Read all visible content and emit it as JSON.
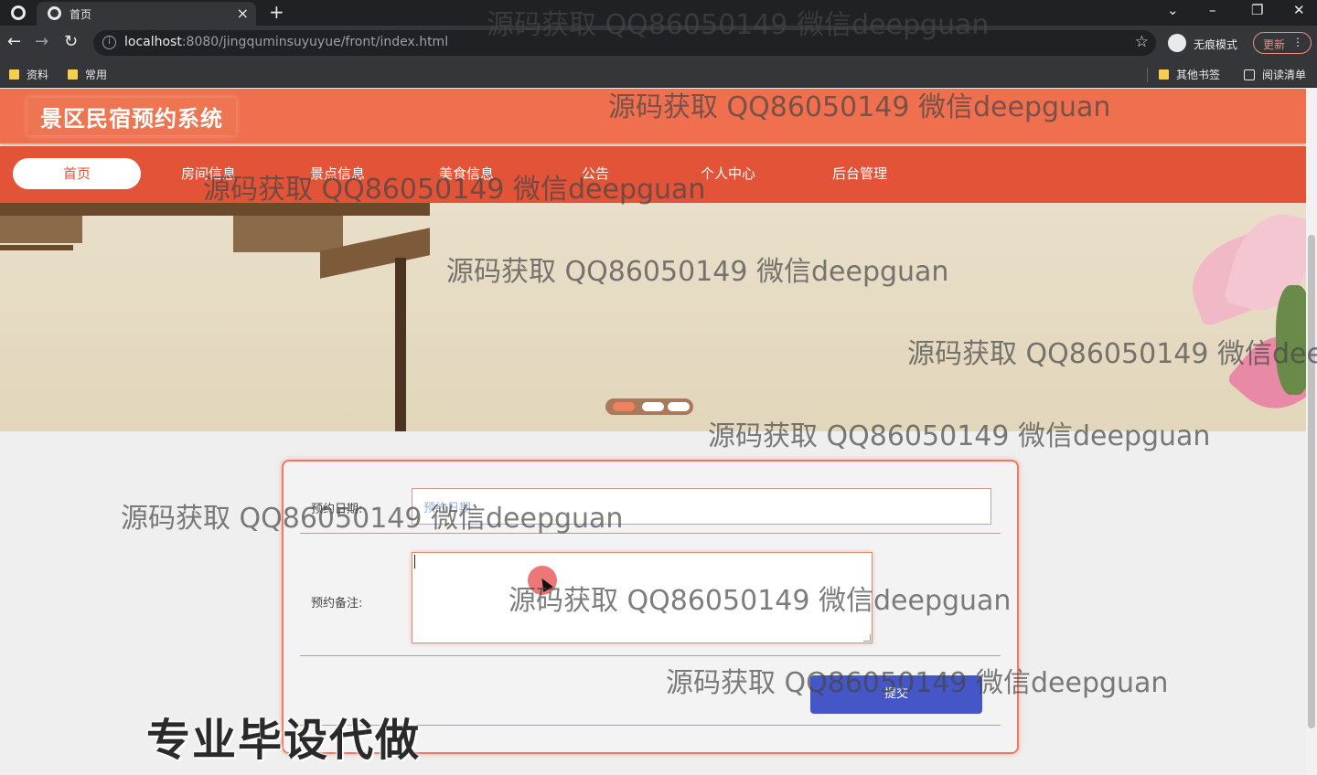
{
  "browser": {
    "tab_title": "首页",
    "new_tab_symbol": "+",
    "url_host": "localhost",
    "url_rest": ":8080/jingquminsuyuyue/front/index.html",
    "incognito_label": "无痕模式",
    "update_label": "更新",
    "bookmarks_left": [
      "资料",
      "常用"
    ],
    "bookmarks_right": [
      "其他书签",
      "阅读清单"
    ]
  },
  "site": {
    "logo": "景区民宿预约系统",
    "nav": [
      {
        "label": "首页",
        "active": true
      },
      {
        "label": "房间信息",
        "active": false
      },
      {
        "label": "景点信息",
        "active": false
      },
      {
        "label": "美食信息",
        "active": false
      },
      {
        "label": "公告",
        "active": false
      },
      {
        "label": "个人中心",
        "active": false
      },
      {
        "label": "后台管理",
        "active": false
      }
    ],
    "carousel": {
      "slides": 3,
      "active_index": 0
    }
  },
  "form": {
    "date_label": "预约日期:",
    "date_placeholder": "预约日期",
    "note_label": "预约备注:",
    "submit_label": "提交"
  },
  "overlay": {
    "watermark_text": "源码获取 QQ86050149 微信deepguan",
    "promo_text": "专业毕设代做"
  },
  "colors": {
    "header": "#ef6f4f",
    "nav_bar": "#e25337",
    "panel_border": "#ef7a63",
    "submit_button": "#4556c7"
  }
}
